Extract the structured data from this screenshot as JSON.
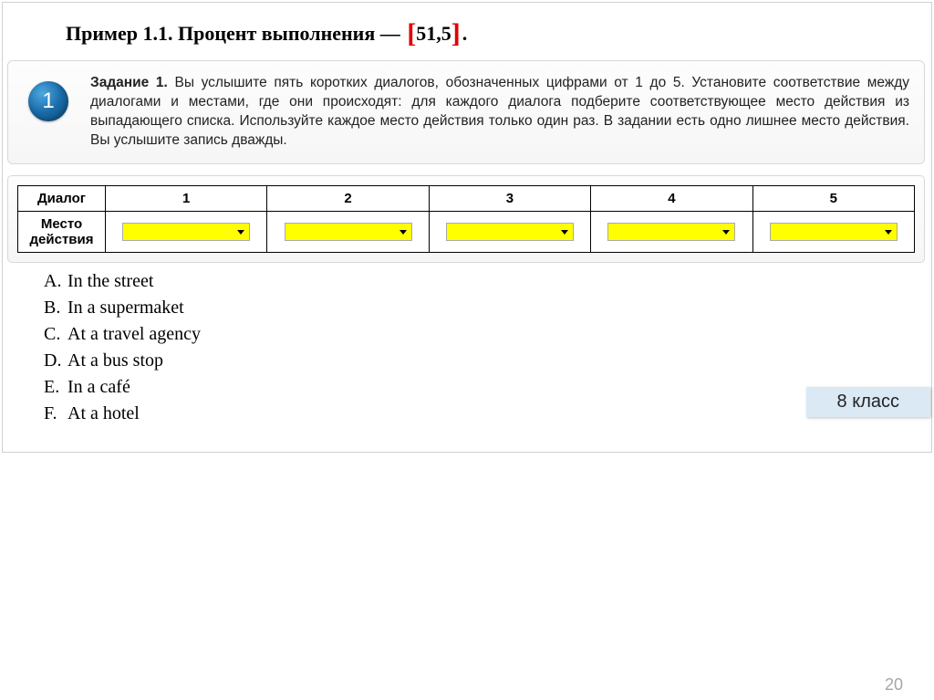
{
  "title": {
    "prefix": "Пример 1.1. Процент выполнения — ",
    "value": "51,5",
    "suffix": "."
  },
  "task": {
    "number": "1",
    "lead": "Задание 1.",
    "text": " Вы услышите пять коротких диалогов, обозначенных цифрами от 1 до 5. Установите соответствие между диалогами и местами, где они происходят: для каждого диалога подберите соответствующее место действия из выпадающего списка. Используйте каждое место действия только один раз. В задании есть одно лишнее место действия. Вы услышите запись дважды."
  },
  "table": {
    "row1_label": "Диалог",
    "row2_label": "Место действия",
    "cols": [
      "1",
      "2",
      "3",
      "4",
      "5"
    ]
  },
  "options": [
    {
      "letter": "A.",
      "text": "In the street"
    },
    {
      "letter": "B.",
      "text": "In a supermaket"
    },
    {
      "letter": "C.",
      "text": "At a travel agency"
    },
    {
      "letter": "D.",
      "text": "At a bus stop"
    },
    {
      "letter": "E.",
      "text": "In a café"
    },
    {
      "letter": "F.",
      "text": "At a hotel"
    }
  ],
  "grade_tag": "8 класс",
  "page_number": "20"
}
